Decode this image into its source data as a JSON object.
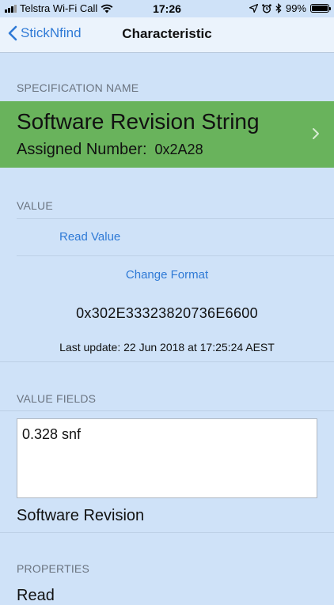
{
  "status_bar": {
    "carrier": "Telstra Wi-Fi Call",
    "time": "17:26",
    "battery_text": "99%",
    "battery_level": 0.99
  },
  "nav": {
    "back_label": "StickNfind",
    "title": "Characteristic"
  },
  "spec": {
    "header": "SPECIFICATION NAME",
    "name": "Software Revision String",
    "assigned_label": "Assigned Number:",
    "assigned_value": "0x2A28"
  },
  "value_section": {
    "header": "VALUE",
    "read_label": "Read Value",
    "format_label": "Change Format",
    "hex_value": "0x302E33323820736E6600",
    "last_update": "Last update: 22 Jun 2018 at 17:25:24 AEST"
  },
  "fields_section": {
    "header": "VALUE FIELDS",
    "field_value": "0.328 snf",
    "field_label": "Software Revision"
  },
  "properties_section": {
    "header": "PROPERTIES",
    "first_item_partial": "Read"
  },
  "colors": {
    "background": "#cfe2f8",
    "accent": "#2f7ad6",
    "spec_row": "#69b35c"
  }
}
